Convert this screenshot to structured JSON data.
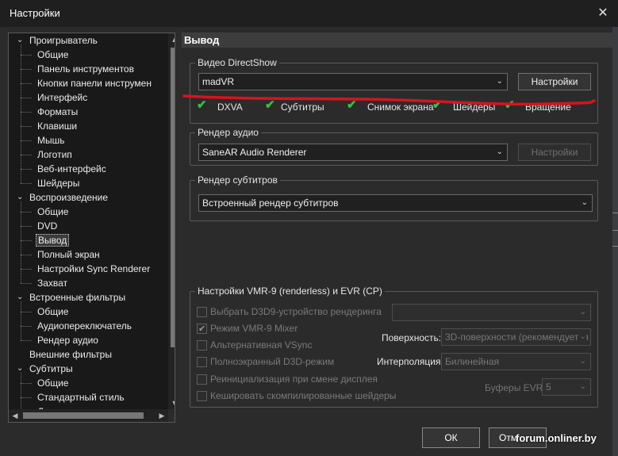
{
  "window": {
    "title": "Настройки"
  },
  "tree": {
    "items": [
      {
        "label": "Проигрыватель",
        "level": 0,
        "expander": "⌄"
      },
      {
        "label": "Общие",
        "level": 1
      },
      {
        "label": "Панель инструментов",
        "level": 1
      },
      {
        "label": "Кнопки панели инструмен",
        "level": 1
      },
      {
        "label": "Интерфейс",
        "level": 1
      },
      {
        "label": "Форматы",
        "level": 1
      },
      {
        "label": "Клавиши",
        "level": 1
      },
      {
        "label": "Мышь",
        "level": 1
      },
      {
        "label": "Логотип",
        "level": 1
      },
      {
        "label": "Веб-интерфейс",
        "level": 1
      },
      {
        "label": "Шейдеры",
        "level": 1
      },
      {
        "label": "Воспроизведение",
        "level": 0,
        "expander": "⌄"
      },
      {
        "label": "Общие",
        "level": 1
      },
      {
        "label": "DVD",
        "level": 1
      },
      {
        "label": "Вывод",
        "level": 1,
        "selected": true
      },
      {
        "label": "Полный экран",
        "level": 1
      },
      {
        "label": "Настройки Sync Renderer",
        "level": 1
      },
      {
        "label": "Захват",
        "level": 1
      },
      {
        "label": "Встроенные фильтры",
        "level": 0,
        "expander": "⌄"
      },
      {
        "label": "Общие",
        "level": 1
      },
      {
        "label": "Аудиопереключатель",
        "level": 1
      },
      {
        "label": "Рендер аудио",
        "level": 1
      },
      {
        "label": "Внешние фильтры",
        "level": 0
      },
      {
        "label": "Субтитры",
        "level": 0,
        "expander": "⌄"
      },
      {
        "label": "Общие",
        "level": 1
      },
      {
        "label": "Стандартный стиль",
        "level": 1
      },
      {
        "label": "Д",
        "level": 1
      }
    ]
  },
  "section": {
    "title": "Вывод"
  },
  "video": {
    "group_title": "Видео DirectShow",
    "renderer": "madVR",
    "settings_label": "Настройки",
    "features": [
      "DXVA",
      "Субтитры",
      "Снимок экрана",
      "Шейдеры",
      "Вращение"
    ]
  },
  "audio": {
    "group_title": "Рендер аудио",
    "renderer": "SaneAR Audio Renderer",
    "settings_label": "Настройки"
  },
  "subs": {
    "group_title": "Рендер субтитров",
    "renderer": "Встроенный рендер субтитров"
  },
  "vmr": {
    "group_title": "Настройки VMR-9 (renderless) и EVR (CP)",
    "checkboxes": [
      {
        "label": "Выбрать D3D9-устройство рендеринга",
        "checked": false
      },
      {
        "label": "Режим VMR-9 Mixer",
        "checked": true
      },
      {
        "label": "Альтернативная VSync",
        "checked": false
      },
      {
        "label": "Полноэкранный D3D-режим",
        "checked": false
      },
      {
        "label": "Реинициализация при смене дисплея",
        "checked": false
      },
      {
        "label": "Кешировать скомпилированные шейдеры",
        "checked": false
      }
    ],
    "device_value": "",
    "surface_label": "Поверхность:",
    "surface_value": "3D-поверхности (рекомендуется",
    "interp_label": "Интерполяция:",
    "interp_value": "Билинейная",
    "buffers_label": "Буферы EVR:",
    "buffers_value": "5"
  },
  "footer": {
    "ok_label": "ОК",
    "cancel_label": "Отм"
  },
  "watermark": "forum.onliner.by",
  "colors": {
    "annotation_red": "#d6141e",
    "check_green": "#36c24a"
  }
}
